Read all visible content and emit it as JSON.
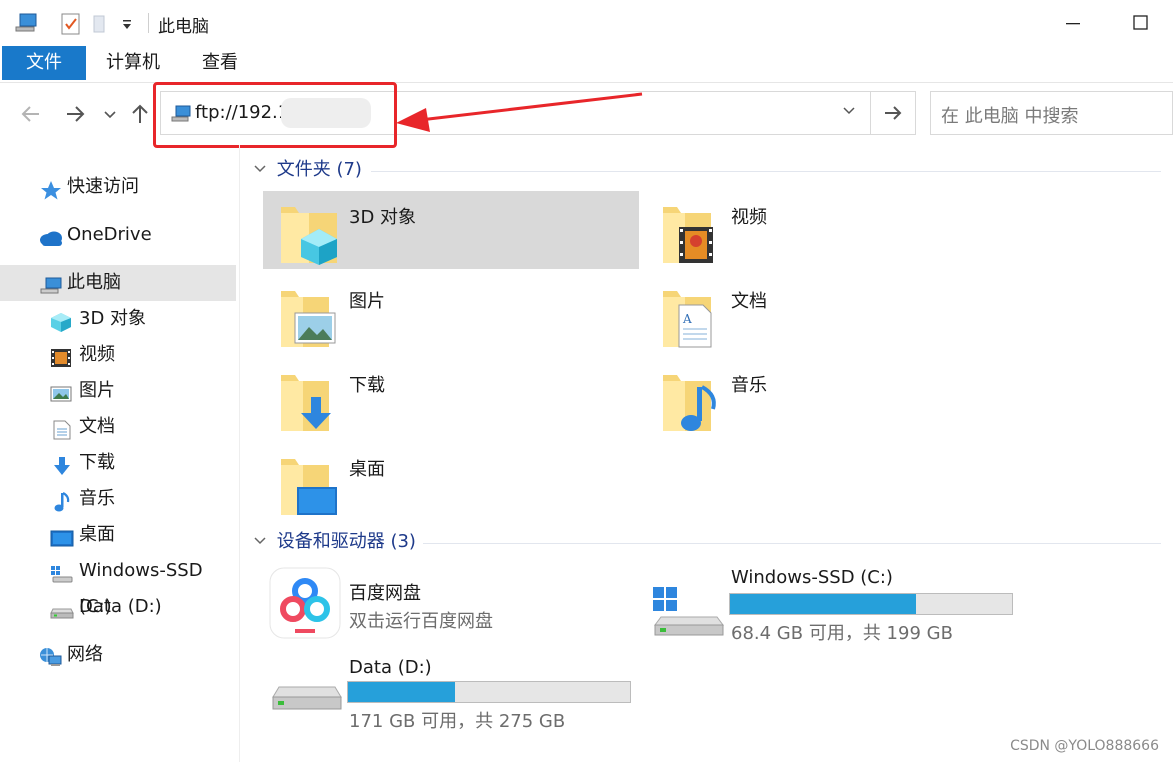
{
  "window": {
    "title": "此电脑",
    "minimize_icon": "minimize-icon",
    "maximize_icon": "maximize-icon"
  },
  "quick_access_toolbar": [
    "computer-icon",
    "properties-icon",
    "new-folder-icon",
    "customize-dropdown-icon"
  ],
  "ribbon": {
    "tabs": [
      {
        "label": "文件",
        "active": true,
        "color": "#1979ca"
      },
      {
        "label": "计算机",
        "active": false
      },
      {
        "label": "查看",
        "active": false
      }
    ]
  },
  "navigation": {
    "back_icon": "back-arrow-icon",
    "forward_icon": "forward-arrow-icon",
    "recent_icon": "recent-locations-chevron-icon",
    "up_icon": "up-arrow-icon",
    "address": "ftp://192.1",
    "address_icon": "computer-icon",
    "search_placeholder": "在 此电脑 中搜索",
    "highlight_color": "#e8262a"
  },
  "sidebar": {
    "items": [
      {
        "label": "快速访问",
        "icon": "star-icon"
      },
      {
        "label": "OneDrive",
        "icon": "cloud-icon"
      },
      {
        "label": "此电脑",
        "icon": "computer-icon",
        "selected": true
      },
      {
        "label": "3D 对象",
        "icon": "cube-icon"
      },
      {
        "label": "视频",
        "icon": "film-icon"
      },
      {
        "label": "图片",
        "icon": "picture-icon"
      },
      {
        "label": "文档",
        "icon": "document-icon"
      },
      {
        "label": "下载",
        "icon": "download-arrow-icon"
      },
      {
        "label": "音乐",
        "icon": "music-note-icon"
      },
      {
        "label": "桌面",
        "icon": "desktop-icon"
      },
      {
        "label": "Windows-SSD (C:)",
        "icon": "windows-drive-icon"
      },
      {
        "label": "Data (D:)",
        "icon": "drive-icon"
      },
      {
        "label": "网络",
        "icon": "network-icon"
      }
    ]
  },
  "folders_group": {
    "header": "文件夹 (7)",
    "items": [
      {
        "label": "3D 对象",
        "icon": "cube-folder-icon",
        "selected": true
      },
      {
        "label": "视频",
        "icon": "video-folder-icon"
      },
      {
        "label": "图片",
        "icon": "pictures-folder-icon"
      },
      {
        "label": "文档",
        "icon": "documents-folder-icon"
      },
      {
        "label": "下载",
        "icon": "downloads-folder-icon"
      },
      {
        "label": "音乐",
        "icon": "music-folder-icon"
      },
      {
        "label": "桌面",
        "icon": "desktop-folder-icon"
      }
    ]
  },
  "devices_group": {
    "header": "设备和驱动器 (3)",
    "items": [
      {
        "name": "百度网盘",
        "subtitle": "双击运行百度网盘",
        "icon": "baidu-netdisk-icon"
      },
      {
        "name": "Windows-SSD (C:)",
        "subtitle": "68.4 GB 可用，共 199 GB",
        "icon": "windows-drive-icon",
        "used_fraction": 0.66
      },
      {
        "name": "Data (D:)",
        "subtitle": "171 GB 可用，共 275 GB",
        "icon": "drive-icon",
        "used_fraction": 0.38
      }
    ]
  },
  "watermark": "CSDN @YOLO888666"
}
